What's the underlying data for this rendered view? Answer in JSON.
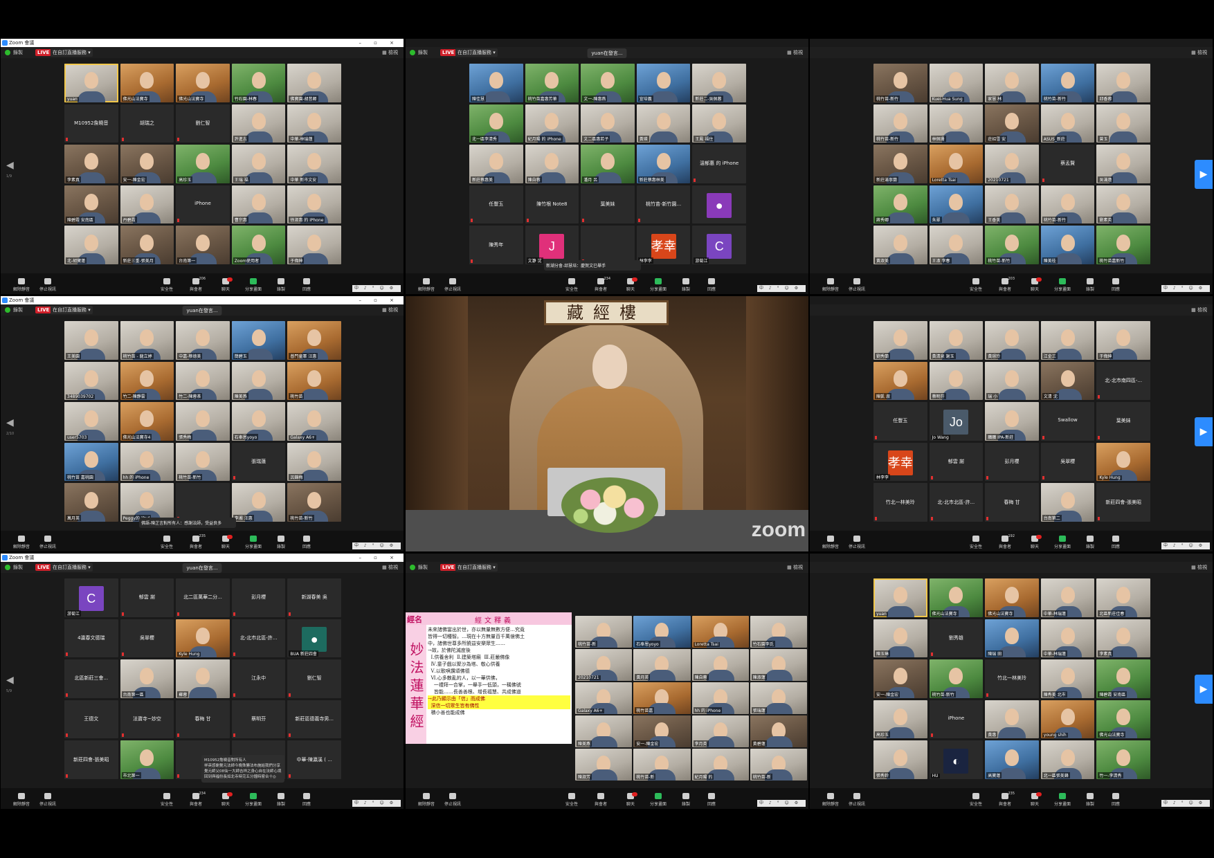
{
  "titles": [
    "Zoom 會議"
  ],
  "toolbar": {
    "record": "錄製",
    "live": "LIVE",
    "stream": "在自訂直播服務",
    "view": "檢視",
    "speaking": "yuan在發言...",
    "pages": [
      "1/9",
      "3/9",
      "2/10",
      "5/9",
      "5/10",
      "1/10"
    ]
  },
  "controls": {
    "mute": "解除靜音",
    "video": "停止視訊",
    "security": "安全性",
    "participants": "與會者",
    "chat": "聊天",
    "share": "分享畫面",
    "record": "錄製",
    "reactions": "回應",
    "counts": [
      "206",
      "234",
      "203",
      "235",
      "192",
      "234",
      "235"
    ],
    "ime": "中 ♪ ° ☺ ⚙"
  },
  "panels": {
    "p0": [
      {
        "n": "yuan",
        "k": "video",
        "c": "w",
        "active": true
      },
      {
        "n": "佛光山法寶寺",
        "k": "video",
        "c": "o"
      },
      {
        "n": "佛光山法寶寺",
        "k": "video",
        "c": "o"
      },
      {
        "n": "竹石園-林春",
        "k": "video",
        "c": "g"
      },
      {
        "n": "佛寶園-胡昔卿",
        "k": "video",
        "c": "w"
      },
      {
        "n": "M10952詹曉音",
        "k": "name"
      },
      {
        "n": "胡瑞之",
        "k": "name"
      },
      {
        "n": "劉仁智",
        "k": "name"
      },
      {
        "n": "許進吉",
        "k": "video",
        "c": "w"
      },
      {
        "n": "中華-林瑞蓮",
        "k": "video",
        "c": "w"
      },
      {
        "n": "李素真",
        "k": "video"
      },
      {
        "n": "安一-陳金宏",
        "k": "video"
      },
      {
        "n": "高珍玉",
        "k": "video",
        "c": "g"
      },
      {
        "n": "王瑞 福",
        "k": "video",
        "c": "w"
      },
      {
        "n": "中華 新市文安",
        "k": "video",
        "c": "w"
      },
      {
        "n": "陳碧霞 安南區",
        "k": "video"
      },
      {
        "n": "丹碧霞",
        "k": "video",
        "c": "w"
      },
      {
        "n": "iPhone",
        "k": "name"
      },
      {
        "n": "曹宗惠",
        "k": "video",
        "c": "w"
      },
      {
        "n": "徐淑惠 的 iPhone",
        "k": "video",
        "c": "w"
      },
      {
        "n": "北-胡寶蓮",
        "k": "video",
        "c": "w"
      },
      {
        "n": "新莊三重-張美月",
        "k": "video"
      },
      {
        "n": "台南第一",
        "k": "video"
      },
      {
        "n": "Zoom使用者",
        "k": "video",
        "c": "g"
      },
      {
        "n": "于偉紳",
        "k": "video",
        "c": "w"
      }
    ],
    "p1": [
      {
        "n": "陳佳慧",
        "k": "video",
        "c": "b"
      },
      {
        "n": "桃竹苗嘉惠芳華",
        "k": "video",
        "c": "g"
      },
      {
        "n": "文一-陳惠燕",
        "k": "video",
        "c": "g"
      },
      {
        "n": "宣培義",
        "k": "video",
        "c": "b"
      },
      {
        "n": "新莊二-吳佩蓉",
        "k": "video",
        "c": "w"
      },
      {
        "n": "北一區李清秀",
        "k": "video",
        "c": "g"
      },
      {
        "n": "紀月陽 的 iPhone",
        "k": "video",
        "c": "w"
      },
      {
        "n": "文二區惠若子",
        "k": "video",
        "c": "w"
      },
      {
        "n": "黃瑛",
        "k": "video",
        "c": "w"
      },
      {
        "n": "王鳳 福住",
        "k": "video",
        "c": "w"
      },
      {
        "n": "新莊蔡惠美",
        "k": "video",
        "c": "w"
      },
      {
        "n": "陳自蓉",
        "k": "video",
        "c": "w"
      },
      {
        "n": "潘月 呂",
        "k": "video",
        "c": "g"
      },
      {
        "n": "新莊蔡惠林美",
        "k": "video",
        "c": "b"
      },
      {
        "n": "溫郁惠 的 iPhone",
        "k": "name"
      },
      {
        "n": "任豐玉",
        "k": "name"
      },
      {
        "n": "陳竹根 Note8",
        "k": "name"
      },
      {
        "n": "葉美妹",
        "k": "name"
      },
      {
        "n": "桃竹苗-新竹園...",
        "k": "name"
      },
      {
        "n": "",
        "k": "avatar",
        "av": "person",
        "col": "#8a3ab9"
      },
      {
        "n": "陳秀年",
        "k": "name"
      },
      {
        "n": "文瀞 沈",
        "k": "avatar",
        "av": "J",
        "col": "#e0307a"
      },
      {
        "n": "",
        "k": "name"
      },
      {
        "n": "林李李",
        "k": "avatar",
        "av": "孝幸",
        "col": "#d8461a"
      },
      {
        "n": "游菊江",
        "k": "avatar",
        "av": "C",
        "col": "#7a45c0"
      }
    ],
    "p2": [
      {
        "n": "桃竹苗-新竹",
        "k": "video"
      },
      {
        "n": "Kuei-Hua Sung",
        "k": "video",
        "c": "w"
      },
      {
        "n": "家慧 林",
        "k": "video",
        "c": "w"
      },
      {
        "n": "桃竹苗-新竹",
        "k": "video",
        "c": "b"
      },
      {
        "n": "邱香蓉",
        "k": "video",
        "c": "w"
      },
      {
        "n": "桃竹苗-新竹",
        "k": "video",
        "c": "w"
      },
      {
        "n": "林佩珊",
        "k": "video",
        "c": "w"
      },
      {
        "n": "莊招雪 安",
        "k": "video"
      },
      {
        "n": "ASUS_新莊",
        "k": "video",
        "c": "w"
      },
      {
        "n": "曾玉",
        "k": "video",
        "c": "w"
      },
      {
        "n": "新莊滿寧蘭",
        "k": "video"
      },
      {
        "n": "Loretta Tsai",
        "k": "video",
        "c": "o"
      },
      {
        "n": "20210721",
        "k": "video",
        "c": "w"
      },
      {
        "n": "蔡孟賢",
        "k": "name"
      },
      {
        "n": "吳滿蓮",
        "k": "video",
        "c": "w"
      },
      {
        "n": "蔣秀卿",
        "k": "video",
        "c": "g"
      },
      {
        "n": "朱翠",
        "k": "video",
        "c": "b"
      },
      {
        "n": "王香美",
        "k": "video",
        "c": "w"
      },
      {
        "n": "桃竹苗-新竹",
        "k": "video",
        "c": "w"
      },
      {
        "n": "劉素英",
        "k": "video",
        "c": "w"
      },
      {
        "n": "黃淑美",
        "k": "video",
        "c": "w"
      },
      {
        "n": "王淑 李春",
        "k": "video",
        "c": "w"
      },
      {
        "n": "桃竹苗-新竹",
        "k": "video",
        "c": "g"
      },
      {
        "n": "陳美桂",
        "k": "video",
        "c": "b"
      },
      {
        "n": "桃竹苗嘉新竹",
        "k": "video",
        "c": "g"
      }
    ],
    "p3": [
      {
        "n": "王美園",
        "k": "video",
        "c": "w"
      },
      {
        "n": "桃竹苗 - 龍立婷",
        "k": "video",
        "c": "w"
      },
      {
        "n": "中嘉-蔡德美",
        "k": "video",
        "c": "w"
      },
      {
        "n": "簡碧玉",
        "k": "video",
        "c": "b"
      },
      {
        "n": "普門童軍 汪惠",
        "k": "video",
        "c": "o"
      },
      {
        "n": "3489039702",
        "k": "video",
        "c": "w"
      },
      {
        "n": "竹二-陳靜雲",
        "k": "video",
        "c": "o"
      },
      {
        "n": "竹二-陳蓉茶",
        "k": "video",
        "c": "w"
      },
      {
        "n": "陳美燕",
        "k": "video",
        "c": "w"
      },
      {
        "n": "桃竹苗",
        "k": "video",
        "c": "o"
      },
      {
        "n": "user5703",
        "k": "video",
        "c": "w"
      },
      {
        "n": "佛光山法寶寺4",
        "k": "video",
        "c": "o"
      },
      {
        "n": "張秀梅",
        "k": "video",
        "c": "w"
      },
      {
        "n": "石奉恩yoyo",
        "k": "video",
        "c": "w"
      },
      {
        "n": "Galaxy A6+",
        "k": "video",
        "c": "w"
      },
      {
        "n": "桃竹苗 嘉桃園",
        "k": "video",
        "c": "b"
      },
      {
        "n": "hh 的 iPhone",
        "k": "video",
        "c": "w"
      },
      {
        "n": "桃竹苗-新竹",
        "k": "video",
        "c": "w"
      },
      {
        "n": "張瑞蓮",
        "k": "name"
      },
      {
        "n": "呂錦梅",
        "k": "video",
        "c": "w"
      },
      {
        "n": "萬月英",
        "k": "video"
      },
      {
        "n": "Peggy的 iPad",
        "k": "video",
        "c": "w"
      },
      {
        "n": "",
        "k": "name"
      },
      {
        "n": "李湘 汪惠",
        "k": "video",
        "c": "w"
      },
      {
        "n": "桃竹苗-新竹",
        "k": "video"
      }
    ],
    "p5": [
      {
        "n": "劉秀蘭",
        "k": "video",
        "c": "w"
      },
      {
        "n": "黃清泉 謝玉",
        "k": "video",
        "c": "w"
      },
      {
        "n": "黃璟玲",
        "k": "video",
        "c": "w"
      },
      {
        "n": "江金三",
        "k": "video",
        "c": "w"
      },
      {
        "n": "于偉紳",
        "k": "video",
        "c": "w"
      },
      {
        "n": "陳凱 淑",
        "k": "video",
        "c": "o"
      },
      {
        "n": "蔡明芬",
        "k": "video",
        "c": "w"
      },
      {
        "n": "瑞 小",
        "k": "video",
        "c": "w"
      },
      {
        "n": "文清 沈",
        "k": "video"
      },
      {
        "n": "北-北市南四區-...",
        "k": "name"
      },
      {
        "n": "任豐玉",
        "k": "name"
      },
      {
        "n": "Jo Wang",
        "k": "avatar",
        "av": "Jo",
        "col": "#4a5a6a"
      },
      {
        "n": "鵬鵬 IPA-新莊",
        "k": "video",
        "c": "w"
      },
      {
        "n": "Swallow",
        "k": "name"
      },
      {
        "n": "葉美妹",
        "k": "name"
      },
      {
        "n": "林李李",
        "k": "avatar",
        "av": "孝幸",
        "col": "#d8461a"
      },
      {
        "n": "郁雲 謝",
        "k": "name"
      },
      {
        "n": "彭月櫻",
        "k": "name"
      },
      {
        "n": "吳翠櫻",
        "k": "name"
      },
      {
        "n": "Kyle Hung",
        "k": "video",
        "c": "o"
      },
      {
        "n": "竹北一林美玲",
        "k": "name"
      },
      {
        "n": "北-北市北區-許...",
        "k": "name"
      },
      {
        "n": "春梅 甘",
        "k": "name"
      },
      {
        "n": "台南第二",
        "k": "video",
        "c": "w"
      },
      {
        "n": "新莊四會-張美昭",
        "k": "name"
      }
    ],
    "p6": [
      {
        "n": "游菊江",
        "k": "avatar",
        "av": "C",
        "col": "#7a45c0"
      },
      {
        "n": "郁雲 謝",
        "k": "name"
      },
      {
        "n": "北二區萬華二分...",
        "k": "name"
      },
      {
        "n": "彭月櫻",
        "k": "name"
      },
      {
        "n": "新湖春美 吳",
        "k": "name"
      },
      {
        "n": "4瀛春文德瑞",
        "k": "name"
      },
      {
        "n": "吳翠櫻",
        "k": "name"
      },
      {
        "n": "Kyle Hung",
        "k": "video",
        "c": "o"
      },
      {
        "n": "北-北市北區-許...",
        "k": "name"
      },
      {
        "n": "BUA 新莊四會",
        "k": "avatar",
        "av": "person",
        "col": "#1d6b5f"
      },
      {
        "n": "北區新莊三會...",
        "k": "name"
      },
      {
        "n": "台南第一區",
        "k": "video",
        "c": "w"
      },
      {
        "n": "蘇蓉",
        "k": "video",
        "c": "w"
      },
      {
        "n": "江永中",
        "k": "name"
      },
      {
        "n": "劉仁智",
        "k": "name"
      },
      {
        "n": "王德文",
        "k": "name"
      },
      {
        "n": "法寶寺~妙空",
        "k": "name"
      },
      {
        "n": "春梅 甘",
        "k": "name"
      },
      {
        "n": "蔡明芬",
        "k": "name"
      },
      {
        "n": "新莊區德義寺男...",
        "k": "name"
      },
      {
        "n": "新莊四會-張美昭",
        "k": "name"
      },
      {
        "n": "市北第一",
        "k": "video",
        "c": "g"
      },
      {
        "n": "",
        "k": "name"
      },
      {
        "n": "黃錦卿, Annie",
        "k": "name"
      },
      {
        "n": "中華-陳瀛溪 ( ...",
        "k": "name"
      }
    ],
    "p7": [
      {
        "n": "桃竹苗-新",
        "k": "video",
        "c": "w"
      },
      {
        "n": "石奉恩yoyo",
        "k": "video",
        "c": "b"
      },
      {
        "n": "Loretta Tsai",
        "k": "video",
        "c": "o"
      },
      {
        "n": "竹石園李氏",
        "k": "video",
        "c": "w"
      },
      {
        "n": "20210721",
        "k": "video",
        "c": "w"
      },
      {
        "n": "黃月英",
        "k": "video",
        "c": "w"
      },
      {
        "n": "陳自蓉",
        "k": "video",
        "c": "w"
      },
      {
        "n": "陳淑蓮",
        "k": "video",
        "c": "w"
      },
      {
        "n": "Galaxy A6+",
        "k": "video",
        "c": "w"
      },
      {
        "n": "桃竹苗嘉",
        "k": "video",
        "c": "o"
      },
      {
        "n": "hh 的 iPhone",
        "k": "video",
        "c": "w"
      },
      {
        "n": "張瑞蓮",
        "k": "video",
        "c": "w"
      },
      {
        "n": "陳美燕",
        "k": "video",
        "c": "w"
      },
      {
        "n": "安一-陳金宏",
        "k": "video"
      },
      {
        "n": "李月英",
        "k": "video",
        "c": "w"
      },
      {
        "n": "黃碧蓮",
        "k": "video"
      },
      {
        "n": "陳淑芳",
        "k": "video",
        "c": "w"
      },
      {
        "n": "桃竹苗-新",
        "k": "video",
        "c": "w"
      },
      {
        "n": "紀月陽 的",
        "k": "video",
        "c": "w"
      },
      {
        "n": "桃竹苗-新",
        "k": "video",
        "c": "w"
      }
    ],
    "p8": [
      {
        "n": "yuan",
        "k": "video",
        "c": "w",
        "active": true
      },
      {
        "n": "佛光山法寶寺",
        "k": "video",
        "c": "g"
      },
      {
        "n": "佛光山法寶寺",
        "k": "video",
        "c": "o"
      },
      {
        "n": "中華-林瑞蓮",
        "k": "video",
        "c": "w"
      },
      {
        "n": "北區新莊佳春",
        "k": "video",
        "c": "w"
      },
      {
        "n": "陳玉琳",
        "k": "video",
        "c": "w"
      },
      {
        "n": "劉秀雄",
        "k": "name"
      },
      {
        "n": "陳瑞 田",
        "k": "video",
        "c": "b"
      },
      {
        "n": "中華-林瑞蓮",
        "k": "video",
        "c": "w"
      },
      {
        "n": "李素真",
        "k": "video",
        "c": "w"
      },
      {
        "n": "安一-陳金宏",
        "k": "video"
      },
      {
        "n": "桃竹苗-新竹",
        "k": "video",
        "c": "g"
      },
      {
        "n": "竹北一林美玲",
        "k": "name"
      },
      {
        "n": "陳秀美 北市",
        "k": "video",
        "c": "w"
      },
      {
        "n": "陳碧霞 安南區",
        "k": "video",
        "c": "g"
      },
      {
        "n": "高珍玉",
        "k": "video",
        "c": "w"
      },
      {
        "n": "iPhone",
        "k": "name"
      },
      {
        "n": "黃惠",
        "k": "video",
        "c": "w"
      },
      {
        "n": "young shih",
        "k": "video",
        "c": "o"
      },
      {
        "n": "佛光山法寶寺",
        "k": "video",
        "c": "g"
      },
      {
        "n": "張秀鈴",
        "k": "video",
        "c": "w"
      },
      {
        "n": "HU",
        "k": "avatar",
        "av": "◐",
        "col": "#1a2440"
      },
      {
        "n": "高寶蓮",
        "k": "video",
        "c": "b"
      },
      {
        "n": "北一區張美鋒",
        "k": "video",
        "c": "w"
      },
      {
        "n": "竹一-李清秀",
        "k": "video",
        "c": "g"
      }
    ]
  },
  "speaker": {
    "plaque": "藏經樓",
    "watermark": "zoom"
  },
  "chat_popups": {
    "p1": "新湖分會-邱慧培：慶賀文巳舉手",
    "p3": "佛語-陳芷言對所有人：感謝法師，受益良多",
    "p6_sender": "M10952詹曉音對所有人",
    "p6_msg": "祥英感謝覺元法師今晚殊勝法布施給我們分享覺元師父08仙一大師吉祥之身心自在法師心境回到與福份長如北寺時完五分鐘時嘗合十◎"
  },
  "slide": {
    "label": "經名",
    "title": "經文釋義",
    "side": "妙法蓮華經",
    "lines": [
      "未來諸佛當出於世，亦以無量無數方便…究竟",
      "皆得一切種智。…現在十方無量百千萬億佛土",
      "中，諸佛世尊多所饒益安樂眾生……",
      "→故，於佛陀滅度後",
      "  Ⅰ.供養舍利  Ⅱ.建築塔廟  Ⅲ.莊嚴佛像",
      "  Ⅳ.童子戲以聚沙為塔、敬心供養",
      "  Ⅴ.以歌唄讚頌佛德",
      "  Ⅵ.心多散亂的人，以一華供佛，",
      "    一禮拜一合掌，一舉手一低頭，一稱佛號",
      "    皆能……長善善根、增長福慧、共成佛道"
    ],
    "highlight1": "→此乃顯示由「信」而成佛",
    "highlight2": "深信一切眾生皆有佛性",
    "last": "積小善也能成佛"
  },
  "colors": {
    "live": "#d0202a",
    "share": "#2dbb5a",
    "accent": "#2d8cff",
    "active": "#f2c84b"
  }
}
